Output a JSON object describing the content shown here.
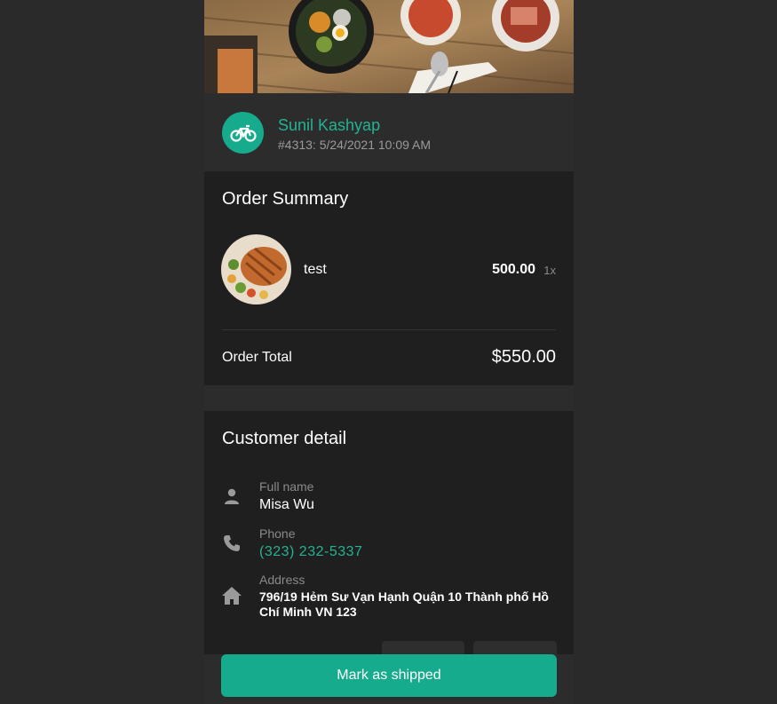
{
  "courier": {
    "name": "Sunil Kashyap",
    "order_meta": "#4313: 5/24/2021 10:09 AM",
    "icon": "bicycle-icon"
  },
  "order_summary": {
    "title": "Order Summary",
    "items": [
      {
        "name": "test",
        "price": "500.00",
        "quantity": "1x"
      }
    ],
    "total_label": "Order Total",
    "total_value": "$550.00"
  },
  "customer": {
    "title": "Customer detail",
    "full_name_label": "Full name",
    "full_name": "Misa Wu",
    "phone_label": "Phone",
    "phone": "(323) 232-5337",
    "address_label": "Address",
    "address": "796/19 Hẻm Sư Vạn Hạnh Quận 10 Thành phố Hồ Chí Minh VN 123"
  },
  "actions": {
    "mark_shipped": "Mark as shipped"
  },
  "colors": {
    "accent": "#17ab8d",
    "accent_text": "#22b393",
    "panel": "#1f1f1f",
    "background": "#2a2a2a"
  }
}
